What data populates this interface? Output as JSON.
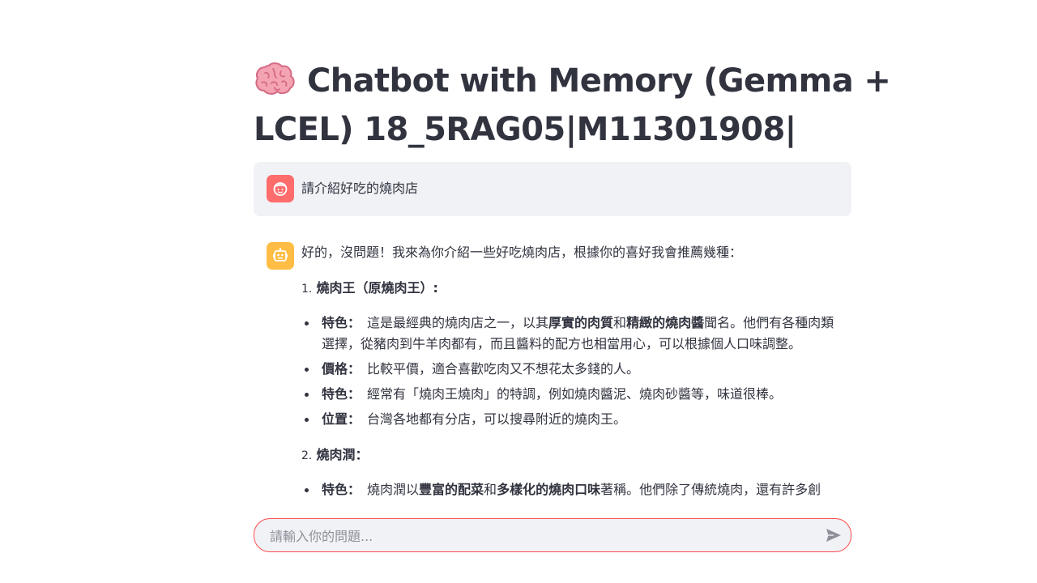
{
  "title": {
    "line1": "Chatbot with Memory (Gemma +",
    "line2": "LCEL) 18_5RAG05|M11301908|",
    "emoji_icon": "brain-icon"
  },
  "user_message": {
    "avatar_icon": "user-face-icon",
    "avatar_color": "#ff6c6c",
    "text": "請介紹好吃的燒肉店"
  },
  "assistant_message": {
    "avatar_icon": "robot-icon",
    "avatar_color": "#ffbd45",
    "intro": "好的，沒問題！我來為你介紹一些好吃燒肉店，根據你的喜好我會推薦幾種：",
    "sections": [
      {
        "number": "1.",
        "name": "燒肉王（原燒肉王）:",
        "items": [
          {
            "label": "特色：",
            "t1": "這是最經典的燒肉店之一，以其",
            "b1": "厚實的肉質",
            "t2": "和",
            "b2": "精緻的燒肉醬",
            "t3": "聞名。他們有各種肉類選擇，從豬肉到牛羊肉都有，而且醬料的配方也相當用心，可以根據個人口味調整。"
          },
          {
            "label": "價格：",
            "text": "比較平價，適合喜歡吃肉又不想花太多錢的人。"
          },
          {
            "label": "特色：",
            "text": "經常有「燒肉王燒肉」的特調，例如燒肉醬泥、燒肉砂醬等，味道很棒。"
          },
          {
            "label": "位置：",
            "text": "台灣各地都有分店，可以搜尋附近的燒肉王。"
          }
        ]
      },
      {
        "number": "2.",
        "name": "燒肉潤：",
        "items": [
          {
            "label": "特色：",
            "t1": "燒肉潤以",
            "b1": "豐富的配菜",
            "t2": "和",
            "b2": "多樣化的燒肉口味",
            "t3": "著稱。他們除了傳統燒肉，還有許多創"
          }
        ]
      }
    ]
  },
  "chat_input": {
    "placeholder": "請輸入你的問題...",
    "value": "",
    "send_icon": "send-icon",
    "border_color": "#ff4b4b"
  }
}
